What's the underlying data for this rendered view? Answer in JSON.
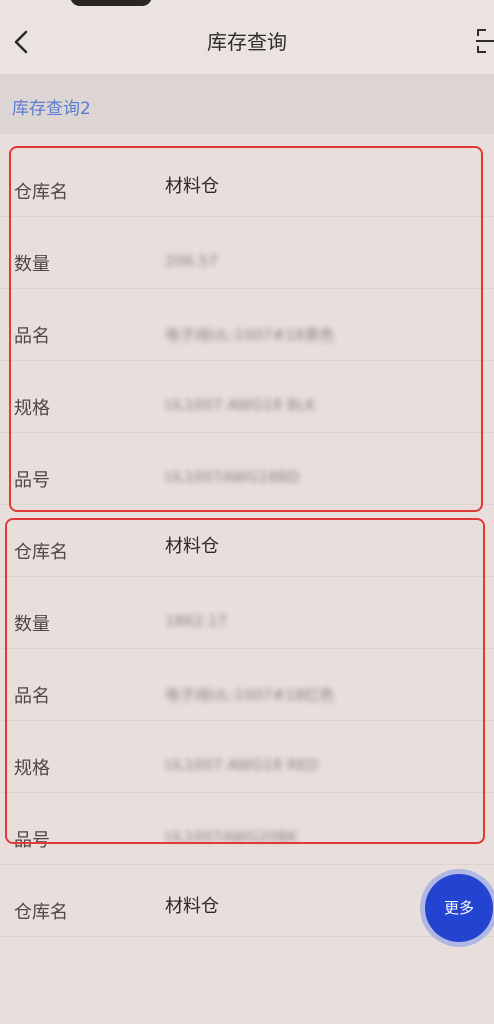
{
  "header": {
    "title": "库存查询"
  },
  "breadcrumb": "库存查询2",
  "records": [
    {
      "warehouse_label": "仓库名",
      "warehouse": "材料仓",
      "qty_label": "数量",
      "qty": "206.57",
      "name_label": "品名",
      "name": "电子线UL-1007#18黑色",
      "spec_label": "规格",
      "spec": "UL1007 AWG18 BLK",
      "code_label": "品号",
      "code": "UL1007AWG18BD"
    },
    {
      "warehouse_label": "仓库名",
      "warehouse": "材料仓",
      "qty_label": "数量",
      "qty": "1862.17",
      "name_label": "品名",
      "name": "电子线UL-1007#18红色",
      "spec_label": "规格",
      "spec": "UL1007 AWG18 RED",
      "code_label": "品号",
      "code": "UL1007AWG20BK"
    },
    {
      "warehouse_label": "仓库名",
      "warehouse": "材料仓"
    }
  ],
  "more_button": "更多",
  "icons": {
    "back": "chevron-left-icon",
    "scan": "scan-icon"
  },
  "colors": {
    "accent": "#2344d0",
    "highlight": "#e13a35",
    "link": "#5b7ccf"
  }
}
